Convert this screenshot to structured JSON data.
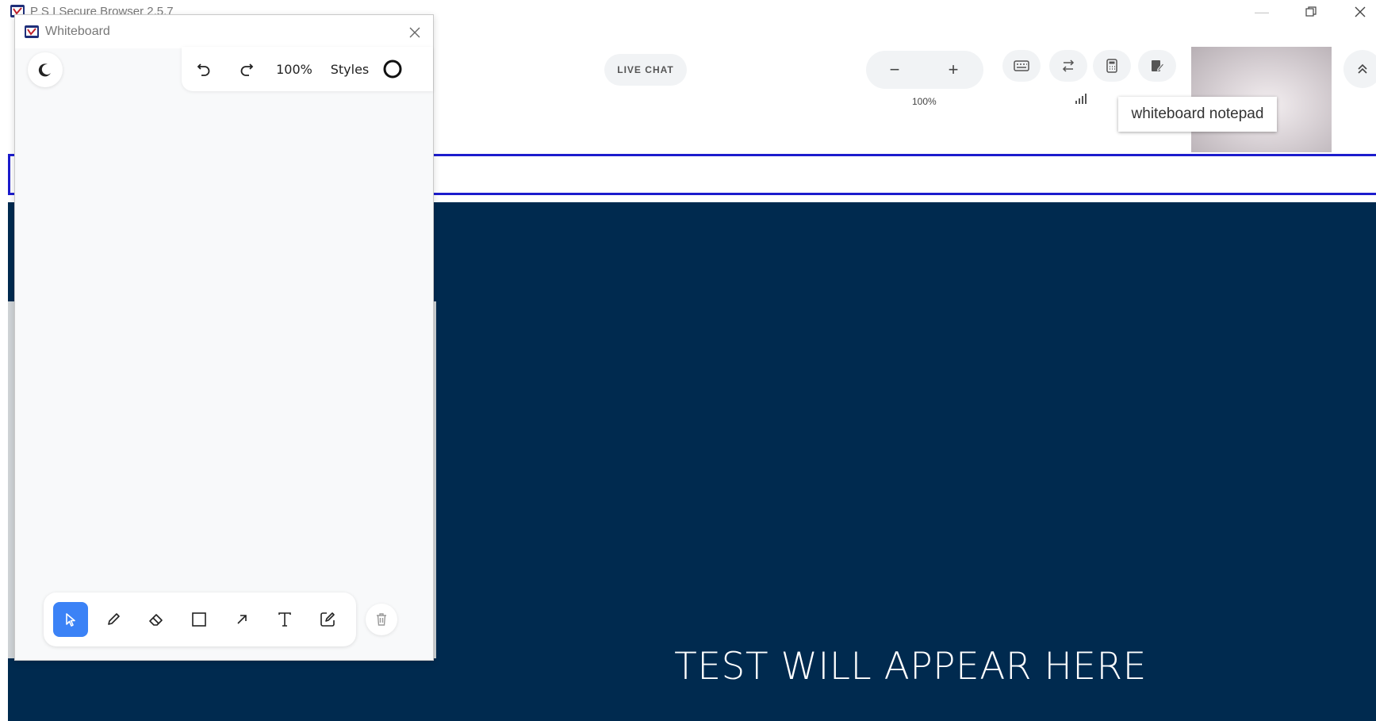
{
  "window": {
    "title": "P S I Secure Browser 2.5.7"
  },
  "toolbar": {
    "live_chat_label": "LIVE CHAT",
    "zoom_minus_label": "−",
    "zoom_plus_label": "+",
    "zoom_value": "100%",
    "tooltip_text": "whiteboard notepad",
    "icons": [
      "keyboard-icon",
      "switch-icon",
      "calculator-icon",
      "notepad-icon",
      "signal-icon",
      "collapse-icon"
    ]
  },
  "content": {
    "placeholder_text": "TEST WILL APPEAR HERE",
    "background_color": "#002a4f",
    "band_color": "#1c1ccd"
  },
  "whiteboard": {
    "title": "Whiteboard",
    "zoom_value": "100%",
    "styles_label": "Styles",
    "tools": [
      "select-tool",
      "pencil-tool",
      "eraser-tool",
      "rectangle-tool",
      "arrow-tool",
      "text-tool",
      "note-tool"
    ],
    "active_tool": "select-tool",
    "active_color": "#3b82f6"
  }
}
